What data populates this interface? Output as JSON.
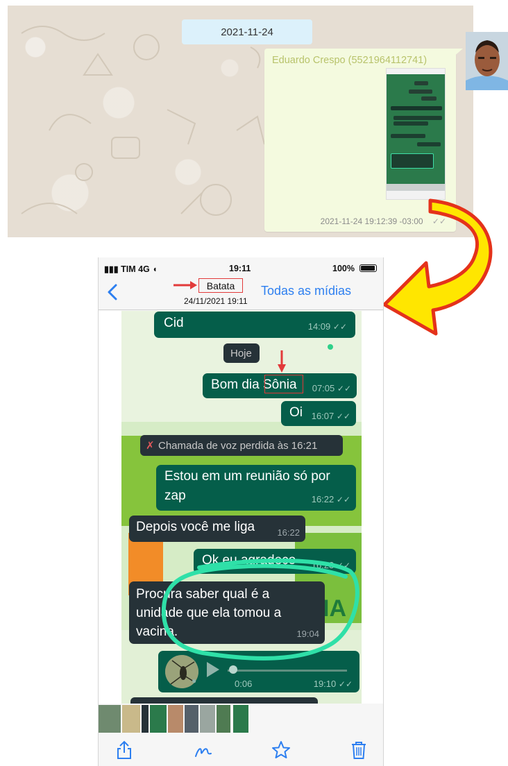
{
  "top_panel": {
    "date_pill": "2021-11-24",
    "sender": "Eduardo Crespo (5521964112741)",
    "timestamp": "2021-11-24 19:12:39 -03:00"
  },
  "phone": {
    "status": {
      "carrier": "TIM 4G",
      "time": "19:11",
      "battery": "100%"
    },
    "nav": {
      "title": "Batata",
      "subtitle": "24/11/2021 19:11",
      "all_media": "Todas as mídias"
    },
    "messages": [
      {
        "id": "m0",
        "text": "Cid",
        "time": "14:09",
        "dir": "out"
      },
      {
        "id": "m1",
        "text": "Hoje",
        "dir": "sys"
      },
      {
        "id": "m2",
        "text": "Bom dia Sônia",
        "time": "07:05",
        "dir": "out"
      },
      {
        "id": "m3",
        "text": "Oi",
        "time": "16:07",
        "dir": "out"
      },
      {
        "id": "m4",
        "text": "Chamada de voz perdida às 16:21",
        "dir": "sys"
      },
      {
        "id": "m5",
        "line1": "Estou em um reunião só por",
        "line2": "zap",
        "time": "16:22",
        "dir": "out"
      },
      {
        "id": "m6",
        "text": "Depois você me liga",
        "time": "16:22",
        "dir": "in"
      },
      {
        "id": "m7",
        "text": "Ok eu agradeço",
        "time": "16:23",
        "dir": "out"
      },
      {
        "id": "m8",
        "line1": "Procura saber qual é a",
        "line2": "unidade que ela tomou a",
        "line3": "vacina.",
        "time": "19:04",
        "dir": "in"
      },
      {
        "id": "m9",
        "duration": "0:06",
        "time": "19:10",
        "dir": "out",
        "kind": "audio"
      }
    ],
    "toolbar_icons": [
      "share-icon",
      "markup-icon",
      "star-icon",
      "trash-icon"
    ]
  },
  "colors": {
    "accent_blue": "#2d7ff0",
    "annotation_red": "#e23a3a",
    "outgoing_bubble": "#055e4a",
    "incoming_bubble": "#263238",
    "scribble_green": "#2fe0a8",
    "arrow_yellow": "#ffe600"
  }
}
